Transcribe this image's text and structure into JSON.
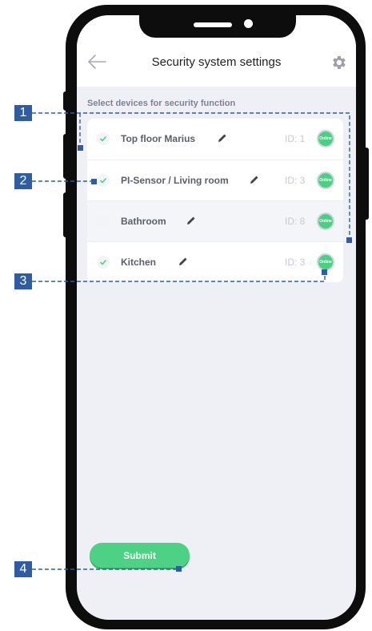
{
  "header": {
    "title": "Security system settings",
    "back_icon": "back-arrow-icon",
    "settings_icon": "gear-icon"
  },
  "section": {
    "label": "Select devices for security function"
  },
  "devices": [
    {
      "name": "Top floor Marius",
      "id": "ID: 1",
      "checked": true,
      "status": "Online"
    },
    {
      "name": "PI-Sensor / Living room",
      "id": "ID: 3",
      "checked": true,
      "status": "Online"
    },
    {
      "name": "Bathroom",
      "id": "ID: 8",
      "checked": false,
      "status": "Online"
    },
    {
      "name": "Kitchen",
      "id": "ID: 3",
      "checked": true,
      "status": "Online"
    }
  ],
  "submit": {
    "label": "Submit"
  },
  "callouts": [
    "1",
    "2",
    "3",
    "4"
  ],
  "colors": {
    "accent_green": "#4cd185",
    "callout_blue": "#2f5da4",
    "frame": "#0d0d0d"
  }
}
